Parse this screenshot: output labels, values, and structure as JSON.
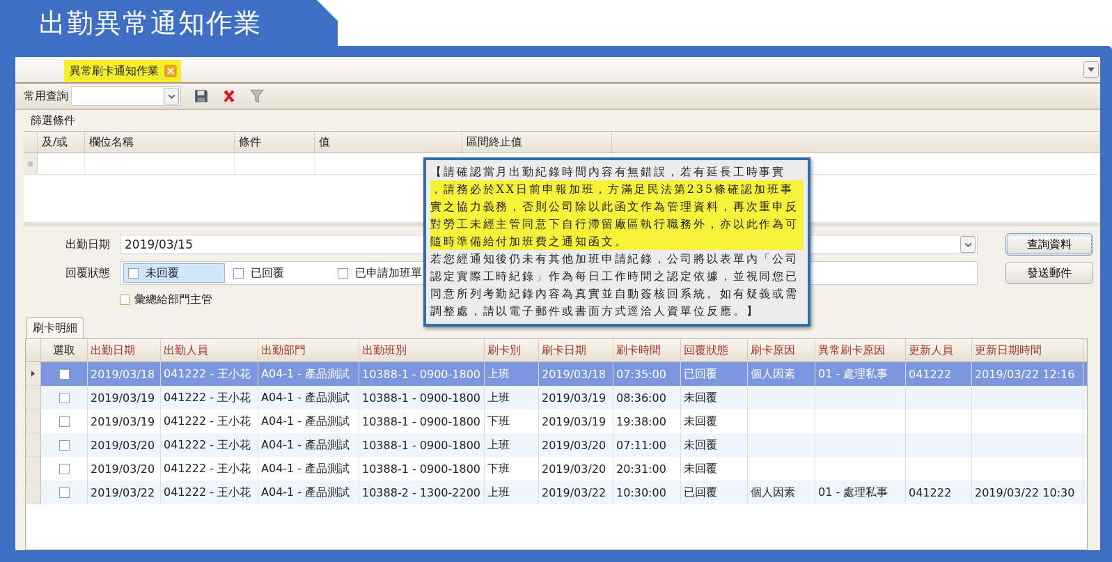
{
  "banner": {
    "title": "出勤異常通知作業"
  },
  "tabs": [
    {
      "label": "異常刷卡通知作業",
      "selected": true
    }
  ],
  "toolbar": {
    "query_label": "常用查詢"
  },
  "filter": {
    "title": "篩選條件",
    "columns": [
      "及/或",
      "欄位名稱",
      "條件",
      "值",
      "區間終止值"
    ]
  },
  "form": {
    "date_label": "出勤日期",
    "date_value": "2019/03/15",
    "status_label": "回覆狀態",
    "status_options": [
      {
        "label": "未回覆",
        "checked": false,
        "highlighted": true
      },
      {
        "label": "已回覆",
        "checked": false,
        "highlighted": false
      },
      {
        "label": "已申請加班單",
        "checked": false,
        "highlighted": false
      }
    ],
    "summary": {
      "label": "彙總給部門主管",
      "checked": false
    },
    "buttons": [
      "查詢資料",
      "發送郵件"
    ]
  },
  "detail_tabs": [
    {
      "label": "刷卡明細",
      "selected": true
    }
  ],
  "grid": {
    "select_header": "選取",
    "columns": [
      "出勤日期",
      "出勤人員",
      "出勤部門",
      "出勤班別",
      "刷卡別",
      "刷卡日期",
      "刷卡時間",
      "回覆狀態",
      "刷卡原因",
      "異常刷卡原因",
      "更新人員",
      "更新日期時間"
    ],
    "rows": [
      {
        "selected": true,
        "checked": false,
        "cells": [
          "2019/03/18",
          "041222 - 王小花",
          "A04-1 - 產品測試",
          "10388-1 - 0900-1800",
          "上班",
          "2019/03/18",
          "07:35:00",
          "已回覆",
          "個人因素",
          "01 - 處理私事",
          "041222",
          "2019/03/22 12:16"
        ]
      },
      {
        "selected": false,
        "checked": false,
        "cells": [
          "2019/03/19",
          "041222 - 王小花",
          "A04-1 - 產品測試",
          "10388-1 - 0900-1800",
          "上班",
          "2019/03/19",
          "08:36:00",
          "未回覆"
        ]
      },
      {
        "selected": false,
        "checked": false,
        "cells": [
          "2019/03/19",
          "041222 - 王小花",
          "A04-1 - 產品測試",
          "10388-1 - 0900-1800",
          "下班",
          "2019/03/19",
          "19:38:00",
          "未回覆"
        ]
      },
      {
        "selected": false,
        "checked": false,
        "cells": [
          "2019/03/20",
          "041222 - 王小花",
          "A04-1 - 產品測試",
          "10388-1 - 0900-1800",
          "上班",
          "2019/03/20",
          "07:11:00",
          "未回覆"
        ]
      },
      {
        "selected": false,
        "checked": false,
        "cells": [
          "2019/03/20",
          "041222 - 王小花",
          "A04-1 - 產品測試",
          "10388-1 - 0900-1800",
          "下班",
          "2019/03/20",
          "20:31:00",
          "未回覆"
        ]
      },
      {
        "selected": false,
        "checked": false,
        "cells": [
          "2019/03/22",
          "041222 - 王小花",
          "A04-1 - 產品測試",
          "10388-2 - 1300-2200",
          "上班",
          "2019/03/22",
          "10:30:00",
          "已回覆",
          "個人因素",
          "01 - 處理私事",
          "041222",
          "2019/03/22 10:30"
        ]
      }
    ]
  },
  "notice": {
    "parts": [
      {
        "text": "【請確認當月出勤紀錄時間內容有無錯誤，若有延長工時事實",
        "highlighted": false
      },
      {
        "text": "，請務必於XX日前申報加班，方滿足民法第235條確認加班事實之協力義務，否則公司除以此函文作為管理資料，再次重申反對勞工未經主管同意下自行滯留廠區執行職務外，亦以此作為可隨時準備給付加班費之通知函文。",
        "highlighted": true
      },
      {
        "text": "若您經通知後仍未有其他加班申請紀錄，公司將以表單內「公司認定實際工時紀錄」作為每日工作時間之認定依據，並視同您已同意所列考勤紀錄內容為真實並自動簽核回系統。如有疑義或需調整處，請以電子郵件或書面方式逕洽人資單位反應。】",
        "highlighted": false
      }
    ]
  }
}
